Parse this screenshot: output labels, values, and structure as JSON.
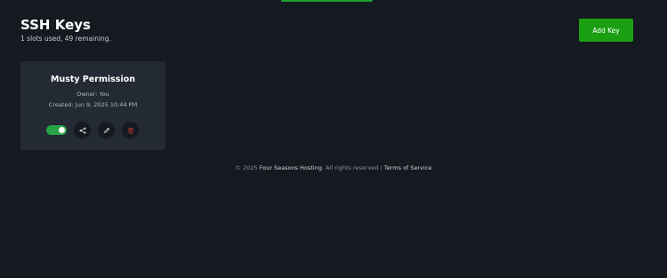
{
  "header": {
    "title": "SSH Keys",
    "slots": "1 slots used, 49 remaining."
  },
  "toolbar": {
    "add_key_label": "Add Key"
  },
  "keys": [
    {
      "name": "Musty Permission",
      "owner": "Owner: You",
      "created": "Created: Jun 9, 2025 10:44 PM",
      "enabled": true
    }
  ],
  "icons": {
    "share": "share-icon",
    "edit": "pencil-icon",
    "delete": "trash-icon"
  },
  "colors": {
    "accent": "#1a9f12",
    "toggle_on": "#2aa347",
    "delete": "#c0392b",
    "background": "#141a20",
    "card": "#232a33"
  },
  "footer": {
    "copyright": "© 2025",
    "company": "Four Seasons Hosting",
    "rights": ". All rights reserved |",
    "terms": "Terms of Service"
  }
}
